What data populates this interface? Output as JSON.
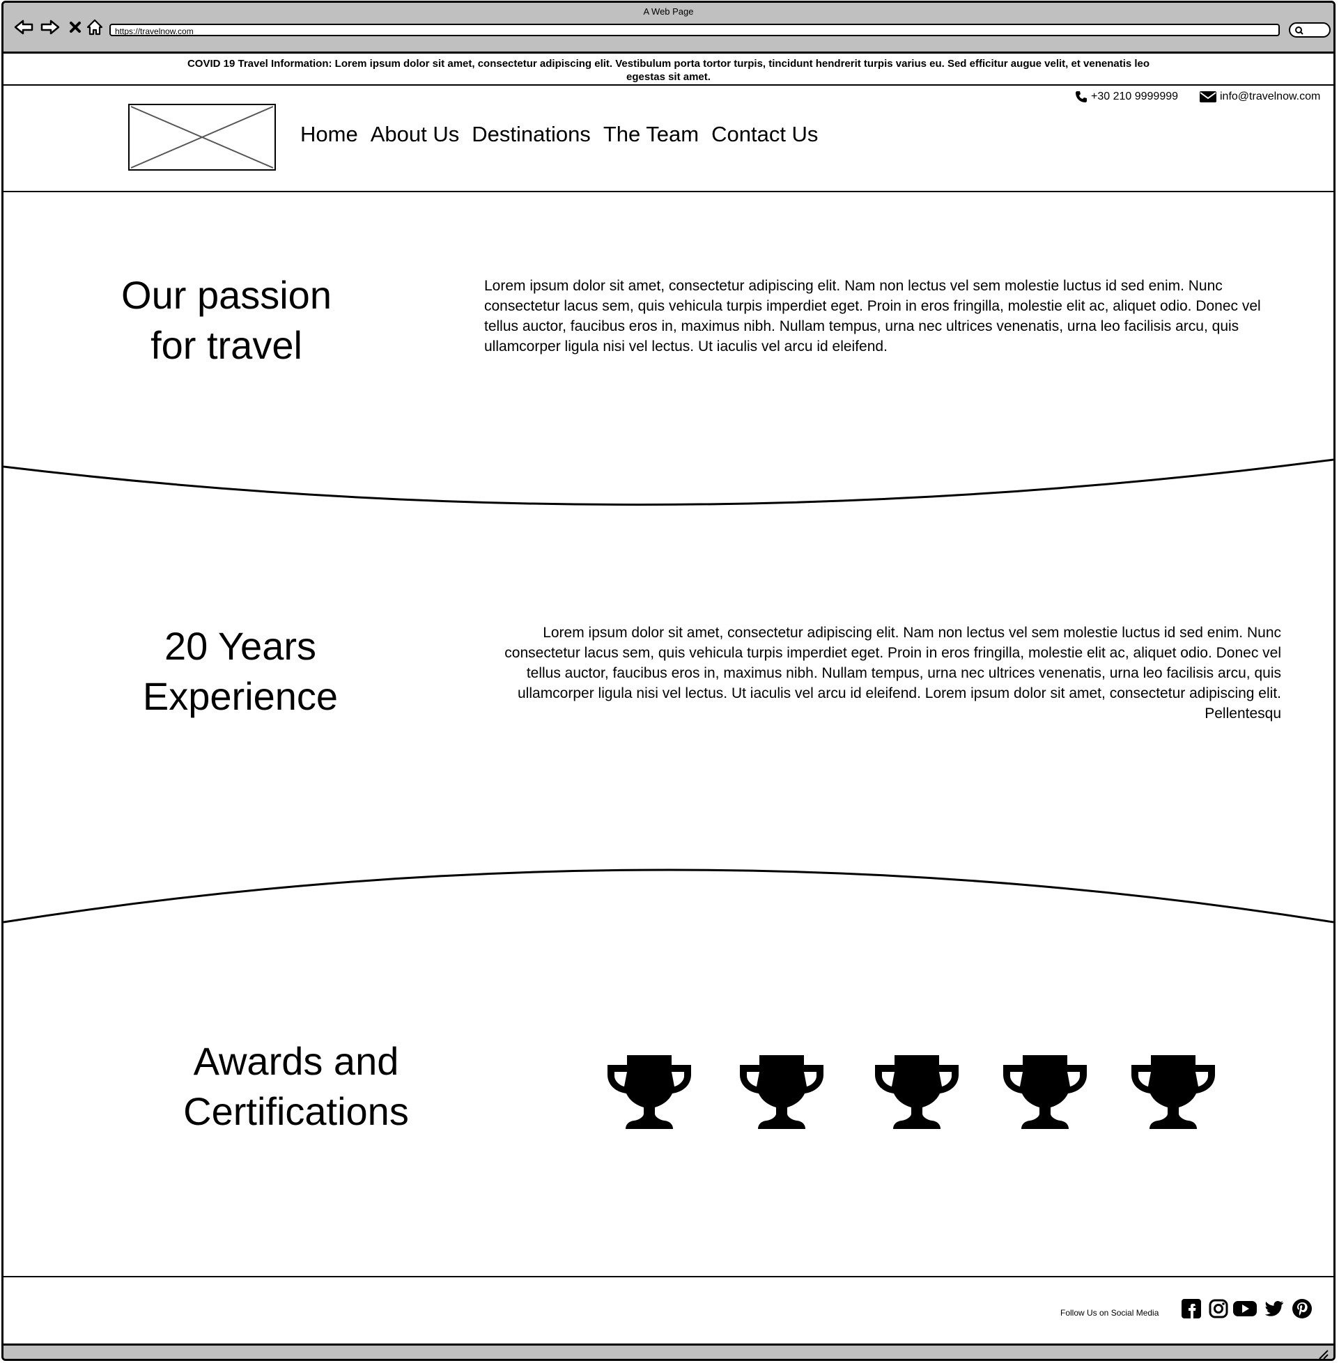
{
  "browser": {
    "title": "A Web Page",
    "url": "https://travelnow.com"
  },
  "covid_banner": "COVID 19 Travel Information: Lorem ipsum dolor sit amet, consectetur adipiscing elit. Vestibulum porta tortor turpis, tincidunt hendrerit turpis varius eu. Sed efficitur augue velit, et venenatis leo egestas sit amet.",
  "header": {
    "phone": "+30 210 9999999",
    "email": "info@travelnow.com",
    "nav": [
      "Home",
      "About Us",
      "Destinations",
      "The Team",
      "Contact Us"
    ]
  },
  "sections": {
    "passion": {
      "heading_line1": "Our passion",
      "heading_line2": "for travel",
      "text": "Lorem ipsum dolor sit amet, consectetur adipiscing elit. Nam non lectus vel sem molestie luctus id sed enim. Nunc consectetur lacus sem, quis vehicula turpis imperdiet eget. Proin in eros fringilla, molestie elit ac, aliquet odio. Donec vel tellus auctor, faucibus eros in, maximus nibh. Nullam tempus, urna nec ultrices venenatis, urna leo facilisis arcu, quis ullamcorper ligula nisi vel lectus. Ut iaculis vel arcu id eleifend."
    },
    "experience": {
      "heading_line1": "20 Years",
      "heading_line2": "Experience",
      "text": "Lorem ipsum dolor sit amet, consectetur adipiscing elit. Nam non lectus vel sem molestie luctus id sed enim. Nunc consectetur lacus sem, quis vehicula turpis imperdiet eget. Proin in eros fringilla, molestie elit ac, aliquet odio. Donec vel tellus auctor, faucibus eros in, maximus nibh. Nullam tempus, urna nec ultrices venenatis, urna leo facilisis arcu, quis ullamcorper ligula nisi vel lectus. Ut iaculis vel arcu id eleifend. Lorem ipsum dolor sit amet, consectetur adipiscing elit. Pellentesqu"
    },
    "awards": {
      "heading_line1": "Awards and",
      "heading_line2": "Certifications",
      "icons": [
        "trophy-icon",
        "trophy-icon",
        "trophy-icon",
        "trophy-icon",
        "trophy-icon"
      ]
    }
  },
  "footer": {
    "follow_text": "Follow Us on Social Media",
    "social_icons": [
      "facebook-icon",
      "instagram-icon",
      "youtube-icon",
      "twitter-icon",
      "pinterest-icon"
    ]
  }
}
